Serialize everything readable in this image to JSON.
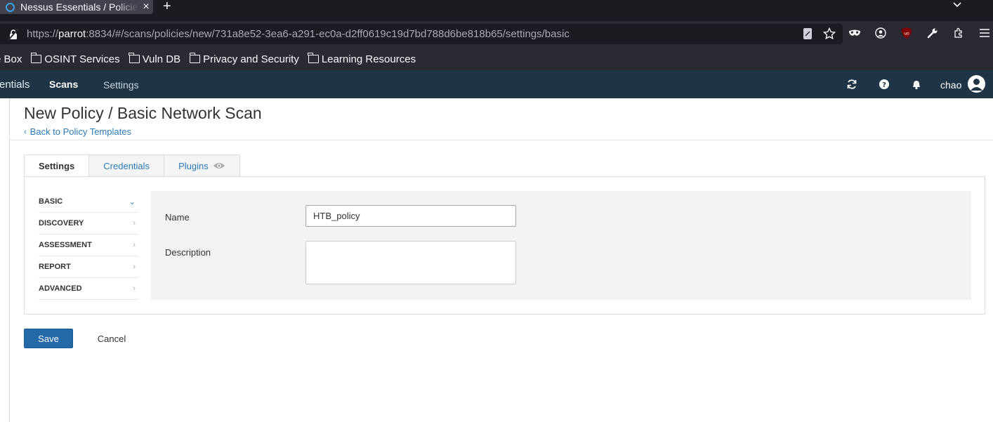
{
  "browser": {
    "tab_title": "Nessus Essentials / Policies",
    "new_tab_label": "+",
    "url_prefix": "https://",
    "url_host": "parrot",
    "url_rest": ":8834/#/scans/policies/new/731a8e52-3ea6-a291-ec0a-d2ff0619c19d7bd788d6be818b65/settings/basic",
    "bookmarks": [
      {
        "label": "e Box",
        "folder": false
      },
      {
        "label": "OSINT Services",
        "folder": true
      },
      {
        "label": "Vuln DB",
        "folder": true
      },
      {
        "label": "Privacy and Security",
        "folder": true
      },
      {
        "label": "Learning Resources",
        "folder": true
      }
    ]
  },
  "header": {
    "brand": "entials",
    "nav_scans": "Scans",
    "nav_settings": "Settings",
    "username": "chao"
  },
  "page": {
    "title": "New Policy / Basic Network Scan",
    "back_link": "Back to Policy Templates",
    "tabs": [
      "Settings",
      "Credentials",
      "Plugins"
    ],
    "side_nav": [
      "BASIC",
      "DISCOVERY",
      "ASSESSMENT",
      "REPORT",
      "ADVANCED"
    ],
    "form": {
      "name_label": "Name",
      "name_value": "HTB_policy",
      "description_label": "Description",
      "description_value": ""
    },
    "save_label": "Save",
    "cancel_label": "Cancel"
  },
  "colors": {
    "header_bg": "#1f3545",
    "link": "#2a7bb7",
    "primary_button": "#2369a8",
    "browser_bg": "#2b2a33"
  }
}
